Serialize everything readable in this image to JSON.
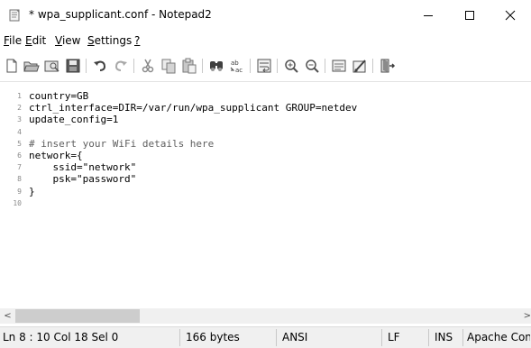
{
  "window": {
    "title": "* wpa_supplicant.conf - Notepad2",
    "icons": {
      "app": "notepad-icon",
      "min": "minimize-icon",
      "max": "maximize-icon",
      "close": "close-icon"
    }
  },
  "menu": {
    "items": [
      {
        "acc": "F",
        "rest": "ile"
      },
      {
        "acc": "E",
        "rest": "dit"
      },
      {
        "acc": "V",
        "rest": "iew"
      },
      {
        "acc": "S",
        "rest": "ettings"
      },
      {
        "acc": "?",
        "rest": ""
      }
    ]
  },
  "toolbar": {
    "buttons": [
      "new-file-icon",
      "open-folder-icon",
      "browse-icon",
      "save-icon",
      "undo-icon",
      "redo-icon",
      "cut-icon",
      "copy-icon",
      "paste-icon",
      "find-icon",
      "replace-icon",
      "word-wrap-icon",
      "zoom-in-icon",
      "zoom-out-icon",
      "view-scheme-icon",
      "customize-scheme-icon",
      "exit-icon"
    ]
  },
  "editor": {
    "lines": [
      {
        "n": "1",
        "text": "country=GB"
      },
      {
        "n": "2",
        "text": "ctrl_interface=DIR=/var/run/wpa_supplicant GROUP=netdev"
      },
      {
        "n": "3",
        "text": "update_config=1"
      },
      {
        "n": "4",
        "text": ""
      },
      {
        "n": "5",
        "text": "# insert your WiFi details here"
      },
      {
        "n": "6",
        "text": "network={"
      },
      {
        "n": "7",
        "text": "    ssid=\"network\""
      },
      {
        "n": "8",
        "text": "    psk=\"password\""
      },
      {
        "n": "9",
        "text": "}"
      },
      {
        "n": "10",
        "text": ""
      }
    ]
  },
  "scrollbar": {
    "left": "<",
    "right": ">"
  },
  "status": {
    "position": "Ln 8 : 10  Col 18  Sel 0",
    "size": "166 bytes",
    "encoding": "ANSI",
    "eol": "LF",
    "mode": "INS",
    "scheme": "Apache Config Files"
  }
}
